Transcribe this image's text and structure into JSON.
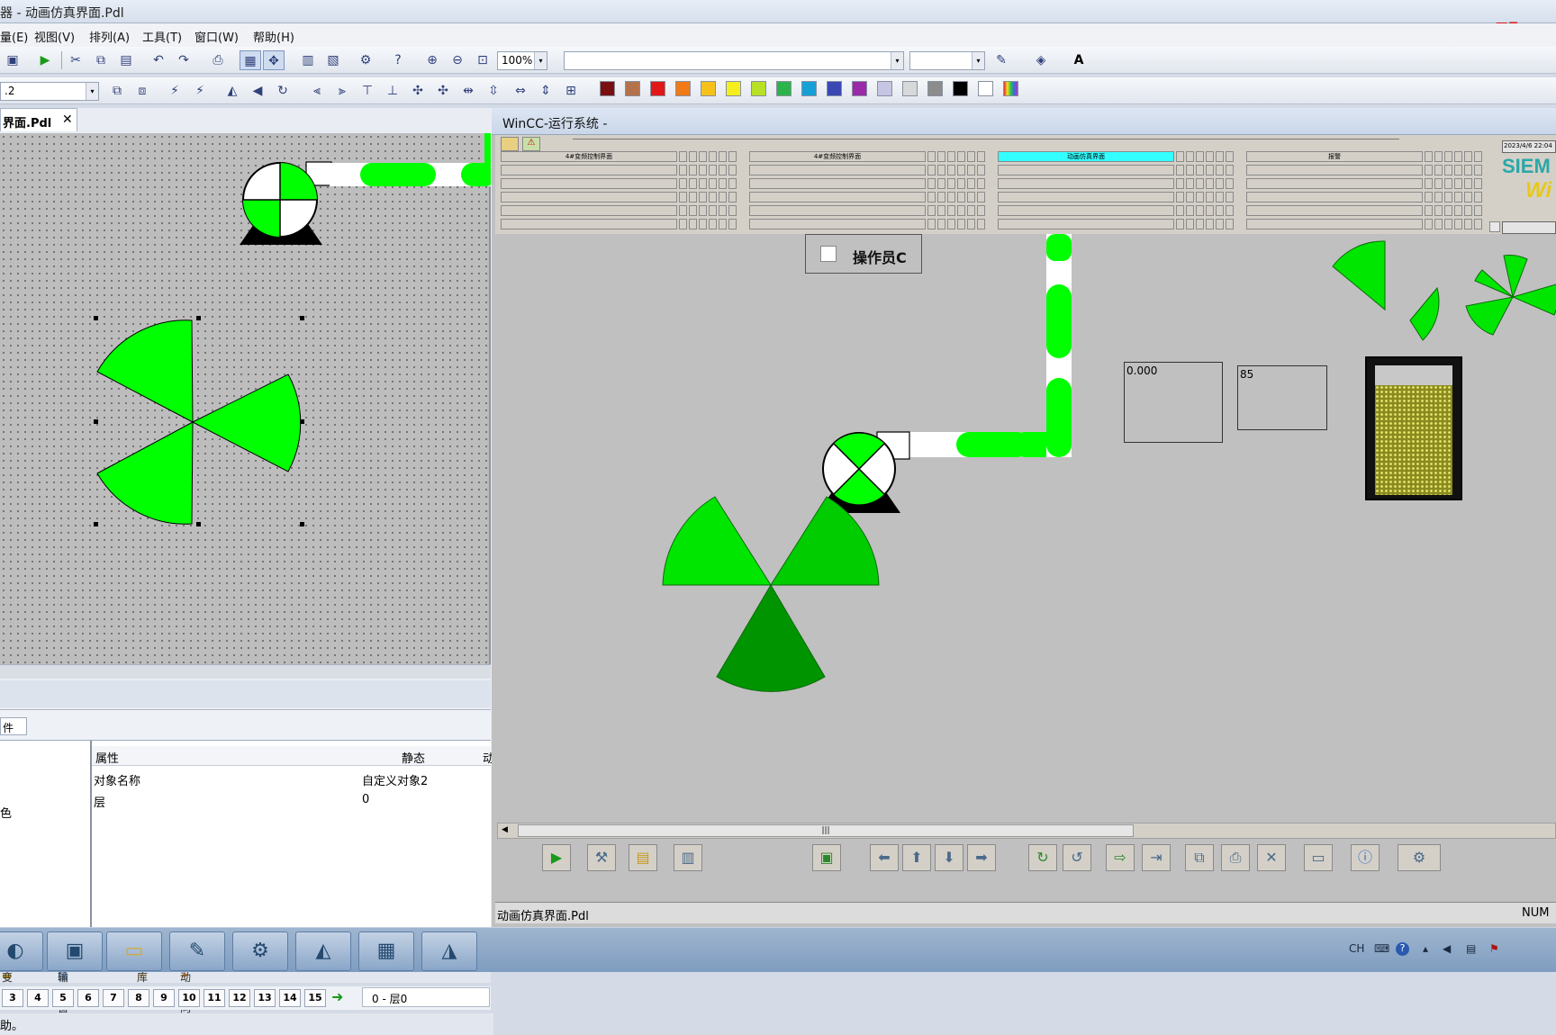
{
  "window": {
    "title": "器 - 动画仿真界面.Pdl",
    "watermark": "殁工"
  },
  "menu": [
    "量(E)",
    "视图(V)",
    "排列(A)",
    "工具(T)",
    "窗口(W)",
    "帮助(H)"
  ],
  "toolbar": {
    "zoom": "100%",
    "zoom_arrow": "▾",
    "layer_field": ".2"
  },
  "palette": [
    "#7a0f12",
    "#b4724c",
    "#e01818",
    "#f07a18",
    "#f6c21a",
    "#f4ee1e",
    "#b8e024",
    "#2cb44a",
    "#16a0d6",
    "#3a48b4",
    "#9a2aa8",
    "#c8c4e4",
    "#d8d8d8",
    "#8c8c8c",
    "#000000",
    "#ffffff"
  ],
  "editor": {
    "tab_label": "界面.Pdl",
    "tab_close": "✕",
    "panel_tab": "件",
    "props": {
      "col_prop": "属性",
      "col_static": "静态",
      "col_dyn": "动",
      "rows": [
        {
          "name": "对象名称",
          "value": "自定义对象2"
        },
        {
          "name": "层",
          "value": "0"
        }
      ],
      "left_char": "色"
    },
    "bottom_tabs": [
      "变量",
      "输出窗口",
      "库",
      "动态向导"
    ],
    "layers": [
      "3",
      "4",
      "5",
      "6",
      "7",
      "8",
      "9",
      "10",
      "11",
      "12",
      "13",
      "14",
      "15"
    ],
    "layer_status": "0 - 层0",
    "status": "助。"
  },
  "runtime": {
    "title": "WinCC-运行系统 -",
    "nav_top_labels": [
      "4#变频控制界面",
      "4#变频控制界面",
      "动画仿真界面",
      "报警"
    ],
    "nav_active": 2,
    "datetime": "2023/4/6 22:04",
    "brand1": "SIEM",
    "brand2": "Wi",
    "operator_label": "操作员C",
    "io1": "0.000",
    "io2": "85",
    "tank_level": 0.85,
    "scroll_mark": "|||",
    "status_text": "动画仿真界面.Pdl",
    "status_right": "NUM"
  },
  "colors": {
    "pipe_green": "#00ff00",
    "fan_green": "#00e600",
    "active_nav": "#33ffff"
  },
  "tray": {
    "lang": "CH"
  }
}
